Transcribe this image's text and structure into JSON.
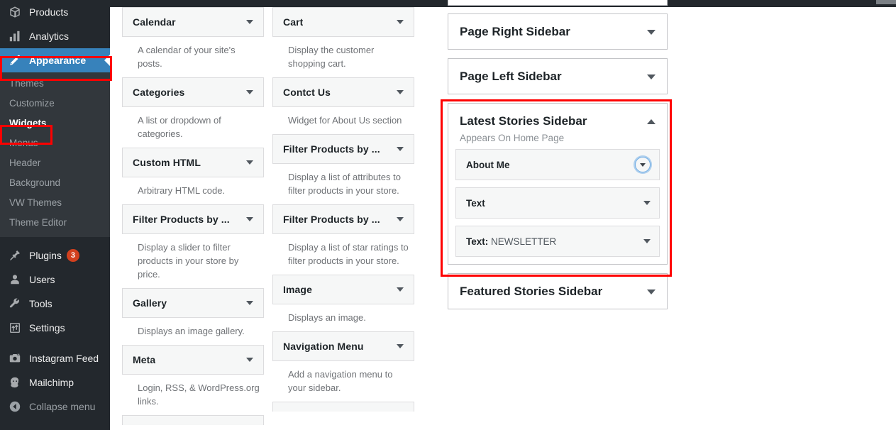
{
  "admin_menu": {
    "items": [
      {
        "label": "Products",
        "icon": "products-icon",
        "state": "normal"
      },
      {
        "label": "Analytics",
        "icon": "analytics-icon",
        "state": "normal"
      },
      {
        "label": "Appearance",
        "icon": "appearance-brush-icon",
        "state": "current"
      }
    ],
    "appearance_submenu": [
      {
        "label": "Themes",
        "current": false
      },
      {
        "label": "Customize",
        "current": false
      },
      {
        "label": "Widgets",
        "current": true
      },
      {
        "label": "Menus",
        "current": false
      },
      {
        "label": "Header",
        "current": false
      },
      {
        "label": "Background",
        "current": false
      },
      {
        "label": "VW Themes",
        "current": false
      },
      {
        "label": "Theme Editor",
        "current": false
      }
    ],
    "items_after": [
      {
        "label": "Plugins",
        "icon": "plugins-plug-icon",
        "badge": "3"
      },
      {
        "label": "Users",
        "icon": "users-person-icon",
        "badge": ""
      },
      {
        "label": "Tools",
        "icon": "tools-wrench-icon",
        "badge": ""
      },
      {
        "label": "Settings",
        "icon": "settings-sliders-icon",
        "badge": ""
      }
    ],
    "items_plugins": [
      {
        "label": "Instagram Feed",
        "icon": "camera-icon"
      },
      {
        "label": "Mailchimp",
        "icon": "mailchimp-monkey-icon"
      }
    ],
    "collapse": {
      "label": "Collapse menu",
      "icon": "collapse-arrow-icon"
    },
    "colors": {
      "background": "#23282d",
      "submenu_background": "#32373c",
      "current_highlight": "#3782bb",
      "badge": "#d2401e",
      "highlight_box": "#ff0000"
    }
  },
  "available_widgets": {
    "left_column": [
      {
        "name": "Calendar",
        "description": "A calendar of your site's posts.",
        "caret": "down"
      },
      {
        "name": "Categories",
        "description": "A list or dropdown of categories.",
        "caret": "down"
      },
      {
        "name": "Custom HTML",
        "description": "Arbitrary HTML code.",
        "caret": "down"
      },
      {
        "name": "Filter Products by ...",
        "description": "Display a slider to filter products in your store by price.",
        "caret": "down"
      },
      {
        "name": "Gallery",
        "description": "Displays an image gallery.",
        "caret": "down"
      },
      {
        "name": "Meta",
        "description": "Login, RSS, & WordPress.org links.",
        "caret": "down"
      }
    ],
    "right_column": [
      {
        "name": "Cart",
        "description": "Display the customer shopping cart.",
        "caret": "down"
      },
      {
        "name": "Contct Us",
        "description": "Widget for About Us section",
        "caret": "down"
      },
      {
        "name": "Filter Products by ...",
        "description": "Display a list of attributes to filter products in your store.",
        "caret": "down"
      },
      {
        "name": "Filter Products by ...",
        "description": "Display a list of star ratings to filter products in your store.",
        "caret": "down"
      },
      {
        "name": "Image",
        "description": "Displays an image.",
        "caret": "down"
      },
      {
        "name": "Navigation Menu",
        "description": "Add a navigation menu to your sidebar.",
        "caret": "down"
      }
    ]
  },
  "sidebars": {
    "items": [
      {
        "title": "Page Right Sidebar",
        "description": "",
        "caret": "down",
        "expanded": false,
        "widgets": []
      },
      {
        "title": "Page Left Sidebar",
        "description": "",
        "caret": "down",
        "expanded": false,
        "widgets": []
      },
      {
        "title": "Latest Stories Sidebar",
        "description": "Appears On Home Page",
        "caret": "up",
        "expanded": true,
        "highlighted": true,
        "widgets": [
          {
            "label": "About Me",
            "sub": "",
            "focused": true,
            "caret": "down"
          },
          {
            "label": "Text",
            "sub": "",
            "focused": false,
            "caret": "down"
          },
          {
            "label": "Text:",
            "sub": " NEWSLETTER",
            "focused": false,
            "caret": "down"
          }
        ]
      },
      {
        "title": "Featured Stories Sidebar",
        "description": "",
        "caret": "down",
        "expanded": false,
        "widgets": []
      }
    ]
  }
}
